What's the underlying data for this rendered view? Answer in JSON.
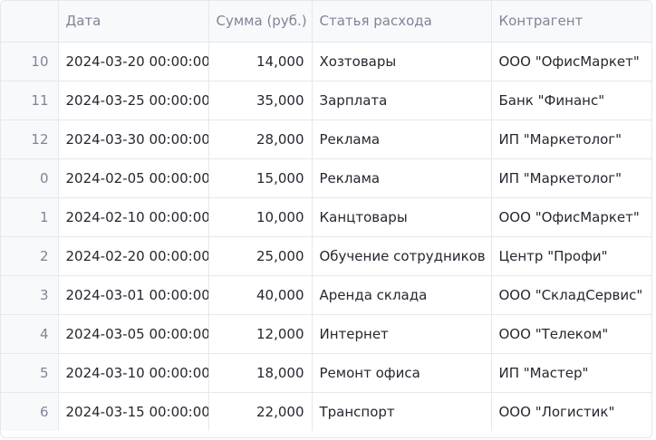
{
  "table": {
    "columns": {
      "index": "",
      "date": "Дата",
      "amount": "Сумма (руб.)",
      "item": "Статья расхода",
      "counterparty": "Контрагент"
    },
    "rows": [
      {
        "index": "10",
        "date": "2024-03-20 00:00:00",
        "amount": "14,000",
        "item": "Хозтовары",
        "counterparty": "ООО \"ОфисМаркет\""
      },
      {
        "index": "11",
        "date": "2024-03-25 00:00:00",
        "amount": "35,000",
        "item": "Зарплата",
        "counterparty": "Банк \"Финанс\""
      },
      {
        "index": "12",
        "date": "2024-03-30 00:00:00",
        "amount": "28,000",
        "item": "Реклама",
        "counterparty": "ИП \"Маркетолог\""
      },
      {
        "index": "0",
        "date": "2024-02-05 00:00:00",
        "amount": "15,000",
        "item": "Реклама",
        "counterparty": "ИП \"Маркетолог\""
      },
      {
        "index": "1",
        "date": "2024-02-10 00:00:00",
        "amount": "10,000",
        "item": "Канцтовары",
        "counterparty": "ООО \"ОфисМаркет\""
      },
      {
        "index": "2",
        "date": "2024-02-20 00:00:00",
        "amount": "25,000",
        "item": "Обучение сотрудников",
        "counterparty": "Центр \"Профи\""
      },
      {
        "index": "3",
        "date": "2024-03-01 00:00:00",
        "amount": "40,000",
        "item": "Аренда склада",
        "counterparty": "ООО \"СкладСервис\""
      },
      {
        "index": "4",
        "date": "2024-03-05 00:00:00",
        "amount": "12,000",
        "item": "Интернет",
        "counterparty": "ООО \"Телеком\""
      },
      {
        "index": "5",
        "date": "2024-03-10 00:00:00",
        "amount": "18,000",
        "item": "Ремонт офиса",
        "counterparty": "ИП \"Мастер\""
      },
      {
        "index": "6",
        "date": "2024-03-15 00:00:00",
        "amount": "22,000",
        "item": "Транспорт",
        "counterparty": "ООО \"Логистик\""
      }
    ]
  }
}
